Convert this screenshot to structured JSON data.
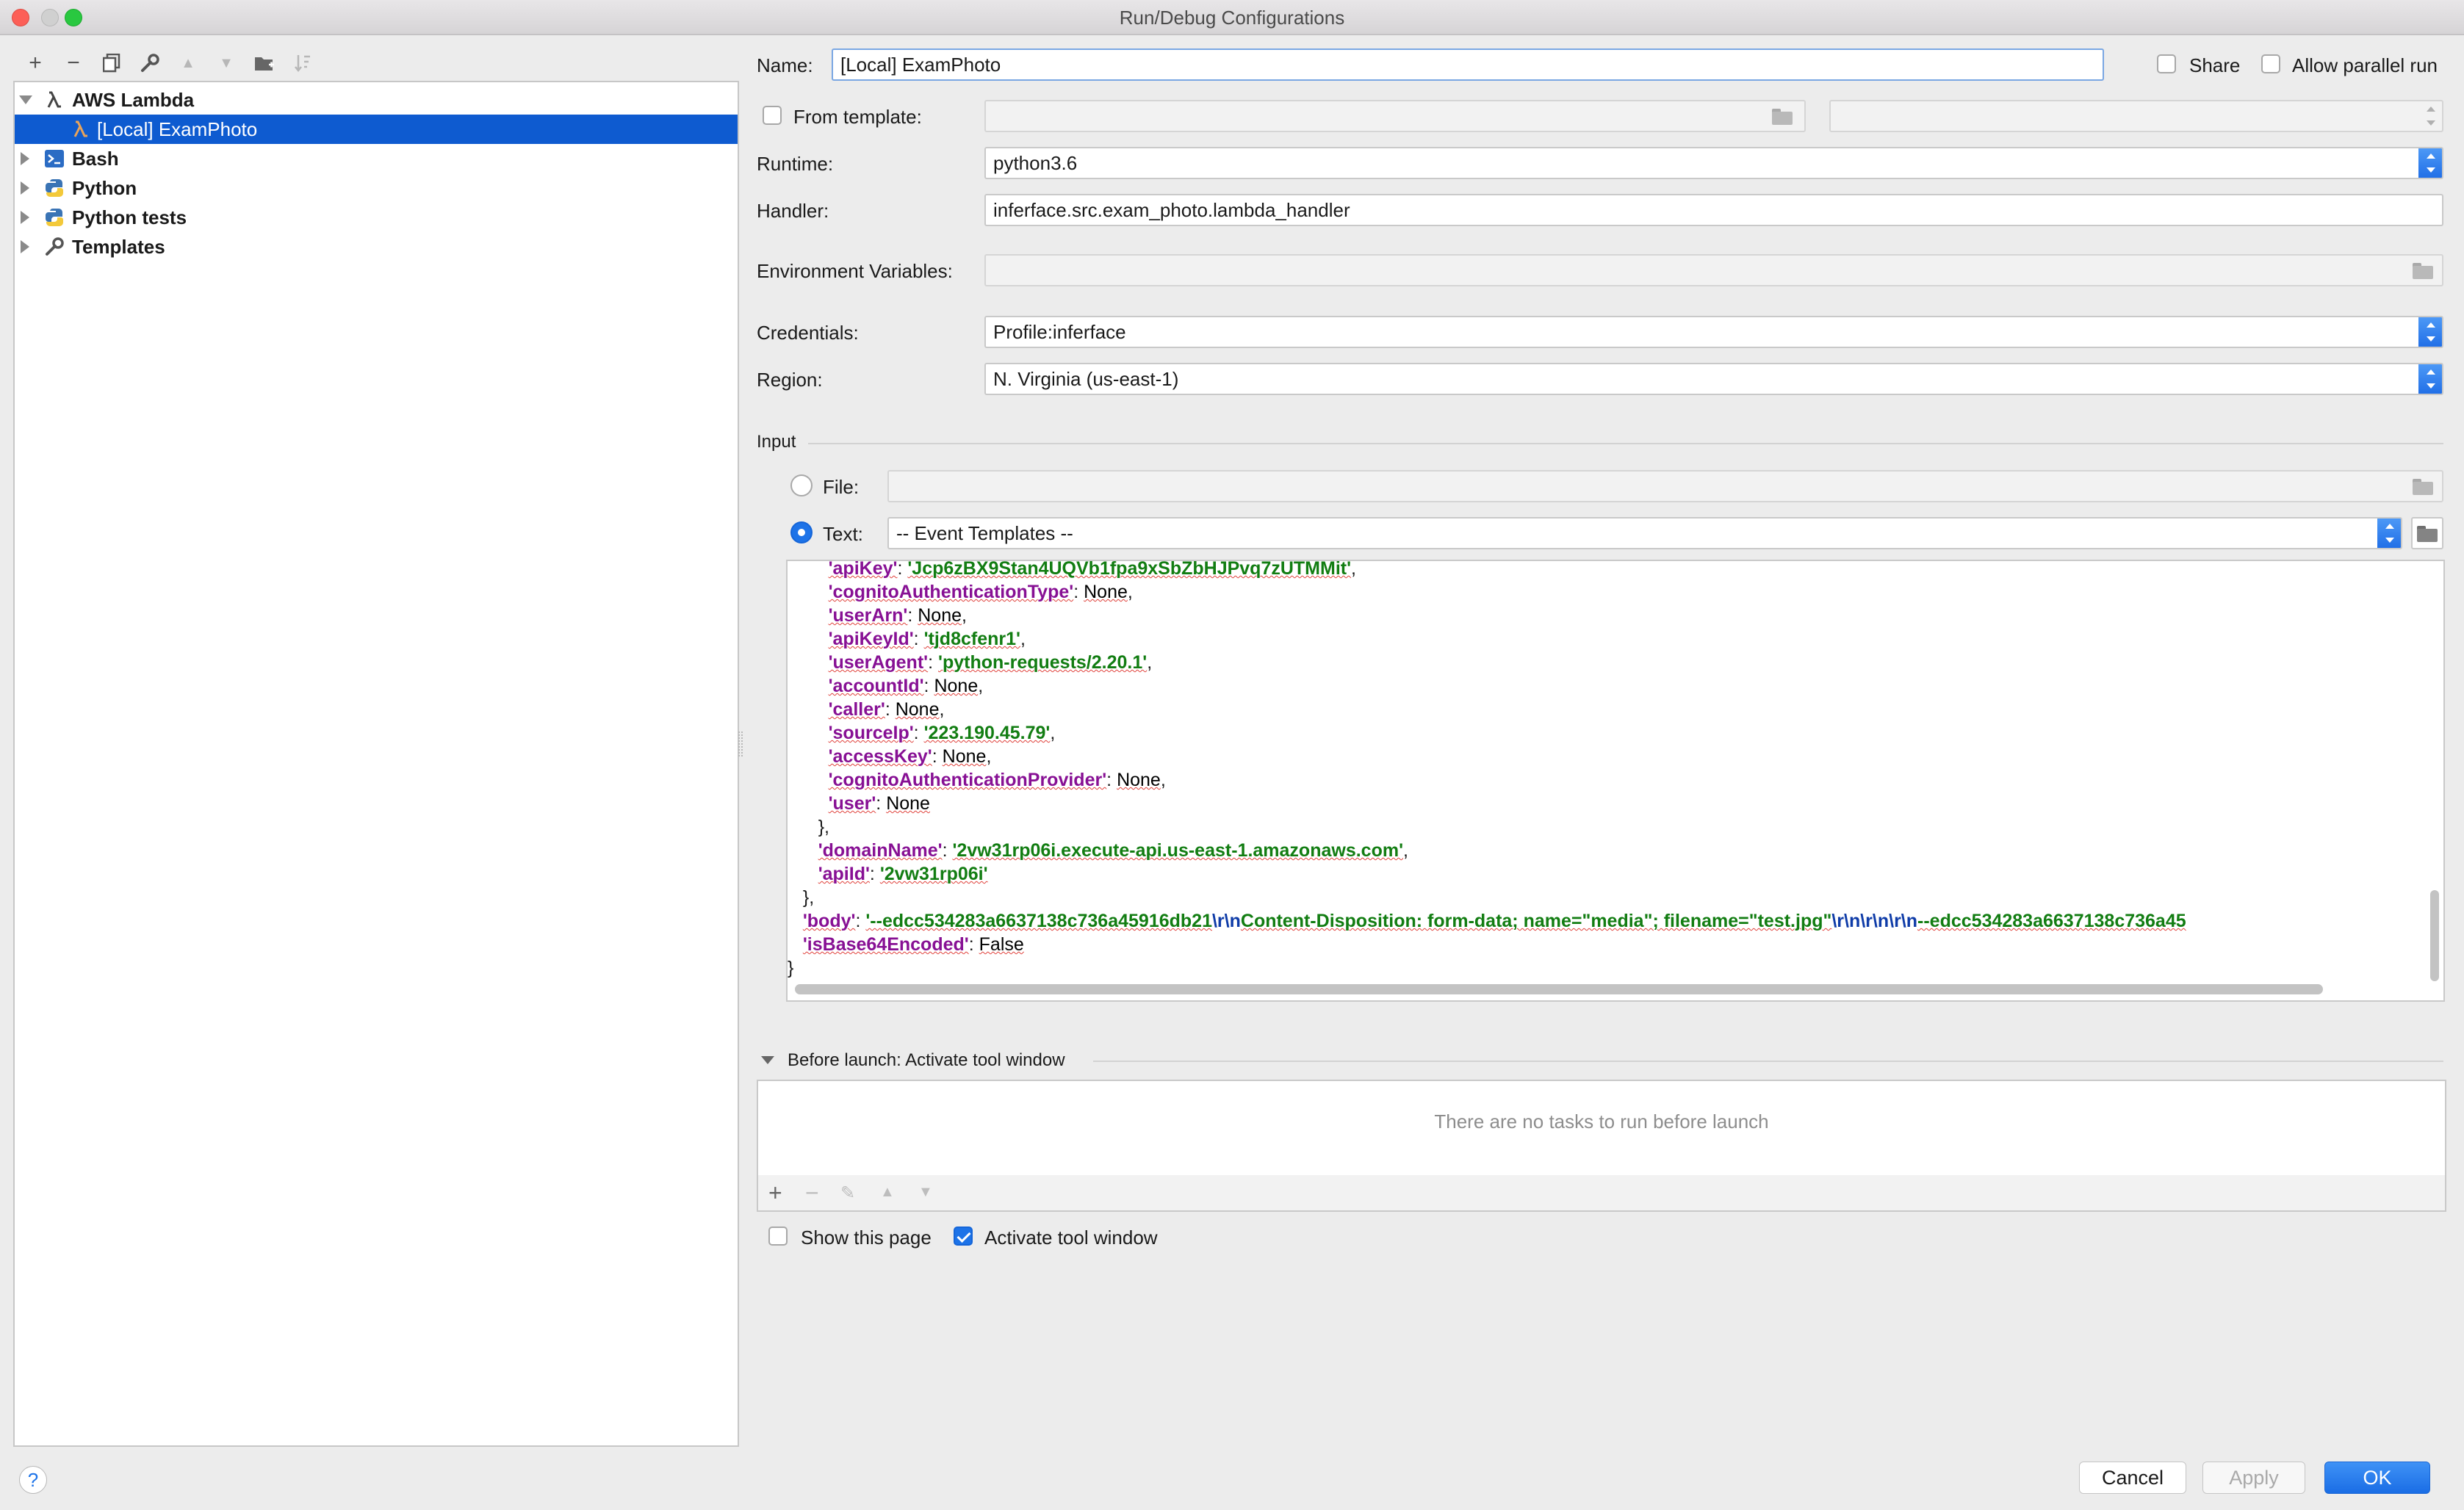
{
  "window": {
    "title": "Run/Debug Configurations"
  },
  "toolbar": {
    "add": "+",
    "remove": "−",
    "copy": "⧉",
    "wrench": "⚒",
    "up": "▲",
    "down": "▼",
    "folder": "▰",
    "sort": "↓"
  },
  "tree": {
    "items": [
      {
        "label": "AWS Lambda",
        "icon": "lambda-icon",
        "expanded": true
      },
      {
        "label": "[Local] ExamPhoto",
        "icon": "lambda-icon",
        "selected": true
      },
      {
        "label": "Bash",
        "icon": "terminal-icon"
      },
      {
        "label": "Python",
        "icon": "python-icon"
      },
      {
        "label": "Python tests",
        "icon": "python-tests-icon"
      },
      {
        "label": "Templates",
        "icon": "wrench-icon"
      }
    ]
  },
  "form": {
    "name_label": "Name:",
    "name_value": "[Local] ExamPhoto",
    "share_label": "Share",
    "parallel_label": "Allow parallel run",
    "from_template_label": "From template:",
    "runtime_label": "Runtime:",
    "runtime_value": "python3.6",
    "handler_label": "Handler:",
    "handler_value": "inferface.src.exam_photo.lambda_handler",
    "env_label": "Environment Variables:",
    "credentials_label": "Credentials:",
    "credentials_value": "Profile:inferface",
    "region_label": "Region:",
    "region_value": "N. Virginia (us-east-1)",
    "input_label": "Input",
    "file_label": "File:",
    "text_label": "Text:",
    "event_templates_value": "-- Event Templates --"
  },
  "code": [
    {
      "indent": "        ",
      "key": "'apiKey'",
      "sep": ": ",
      "val": "'Jcp6zBX9Stan4UQVb1fpa9xSbZbHJPvq7zUTMMit'",
      "type": "str",
      "end": ","
    },
    {
      "indent": "        ",
      "key": "'cognitoAuthenticationType'",
      "sep": ": ",
      "val": "None",
      "type": "none",
      "end": ","
    },
    {
      "indent": "        ",
      "key": "'userArn'",
      "sep": ": ",
      "val": "None",
      "type": "none",
      "end": ","
    },
    {
      "indent": "        ",
      "key": "'apiKeyId'",
      "sep": ": ",
      "val": "'tjd8cfenr1'",
      "type": "str",
      "end": ","
    },
    {
      "indent": "        ",
      "key": "'userAgent'",
      "sep": ": ",
      "val": "'python-requests/2.20.1'",
      "type": "str",
      "end": ","
    },
    {
      "indent": "        ",
      "key": "'accountId'",
      "sep": ": ",
      "val": "None",
      "type": "none",
      "end": ","
    },
    {
      "indent": "        ",
      "key": "'caller'",
      "sep": ": ",
      "val": "None",
      "type": "none",
      "end": ","
    },
    {
      "indent": "        ",
      "key": "'sourceIp'",
      "sep": ": ",
      "val": "'223.190.45.79'",
      "type": "str",
      "end": ","
    },
    {
      "indent": "        ",
      "key": "'accessKey'",
      "sep": ": ",
      "val": "None",
      "type": "none",
      "end": ","
    },
    {
      "indent": "        ",
      "key": "'cognitoAuthenticationProvider'",
      "sep": ": ",
      "val": "None",
      "type": "none",
      "end": ","
    },
    {
      "indent": "        ",
      "key": "'user'",
      "sep": ": ",
      "val": "None",
      "type": "none",
      "end": ""
    },
    {
      "indent": "      ",
      "key": "",
      "sep": "",
      "val": "},",
      "type": "plain",
      "end": ""
    },
    {
      "indent": "      ",
      "key": "'domainName'",
      "sep": ": ",
      "val": "'2vw31rp06i.execute-api.us-east-1.amazonaws.com'",
      "type": "str",
      "end": ","
    },
    {
      "indent": "      ",
      "key": "'apiId'",
      "sep": ": ",
      "val": "'2vw31rp06i'",
      "type": "str",
      "end": ""
    },
    {
      "indent": "   ",
      "key": "",
      "sep": "",
      "val": "},",
      "type": "plain",
      "end": ""
    },
    {
      "indent": "   ",
      "key": "'body'",
      "sep": ": ",
      "val": "BODY",
      "type": "body",
      "end": ""
    },
    {
      "indent": "   ",
      "key": "'isBase64Encoded'",
      "sep": ": ",
      "val": "False",
      "type": "none",
      "end": ""
    },
    {
      "indent": "",
      "key": "",
      "sep": "",
      "val": "}",
      "type": "plain",
      "end": ""
    }
  ],
  "body_parts": [
    {
      "t": "'--edcc534283a6637138c736a45916db21",
      "c": "s"
    },
    {
      "t": "\\r\\n",
      "c": "esc"
    },
    {
      "t": "Content-Disposition: form-data; name=\"media\"; filename=\"test.jpg\"",
      "c": "s"
    },
    {
      "t": "\\r\\n\\r\\n\\r\\n",
      "c": "esc"
    },
    {
      "t": "--edcc534283a6637138c736a45",
      "c": "s"
    }
  ],
  "before_launch": {
    "label": "Before launch: Activate tool window",
    "empty": "There are no tasks to run before launch"
  },
  "options": {
    "show_page": "Show this page",
    "activate_tool": "Activate tool window"
  },
  "buttons": {
    "cancel": "Cancel",
    "apply": "Apply",
    "ok": "OK",
    "help": "?"
  }
}
